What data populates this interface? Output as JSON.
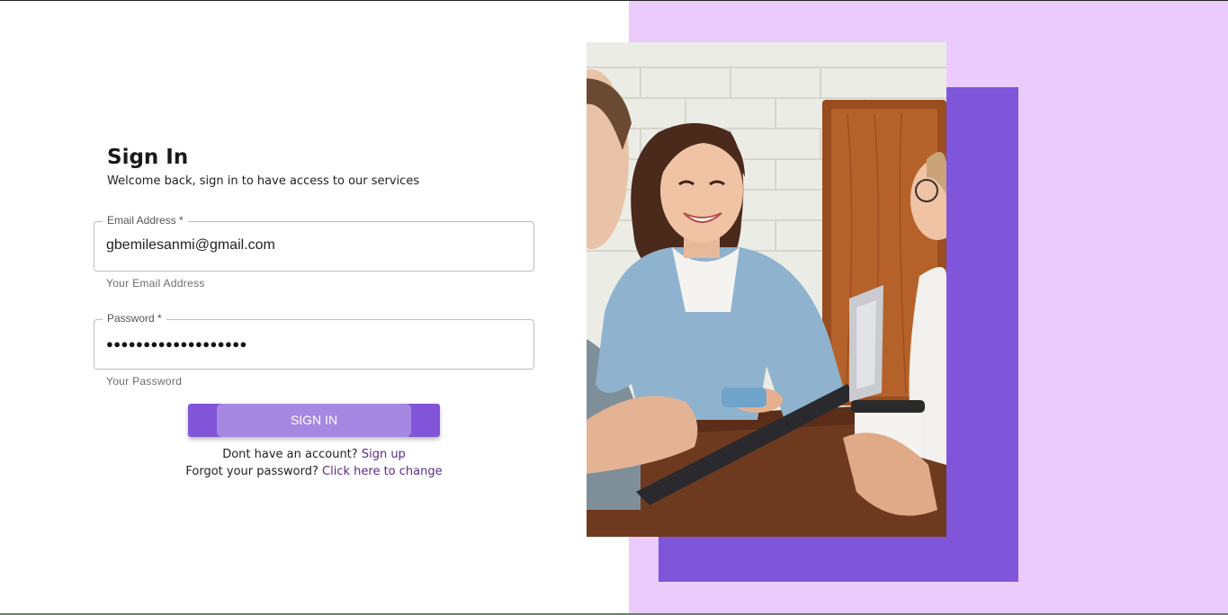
{
  "signin": {
    "title": "Sign In",
    "subtitle": "Welcome back, sign in to have access to our services",
    "email": {
      "label": "Email Address *",
      "value": "gbemilesanmi@gmail.com",
      "helper": "Your Email Address"
    },
    "password": {
      "label": "Password *",
      "value": "●●●●●●●●●●●●●●●●●●●",
      "helper": "Your Password"
    },
    "button_label": "SIGN IN",
    "no_account_text": "Dont have an account?",
    "signup_link": "Sign up",
    "forgot_text": "Forgot your password?",
    "change_link": "Click here to change"
  },
  "colors": {
    "accent": "#8255d8",
    "button_inner": "#a688e3",
    "panel_background": "#ebcbfc",
    "block": "#7f56d9",
    "link": "#5b2a86"
  }
}
